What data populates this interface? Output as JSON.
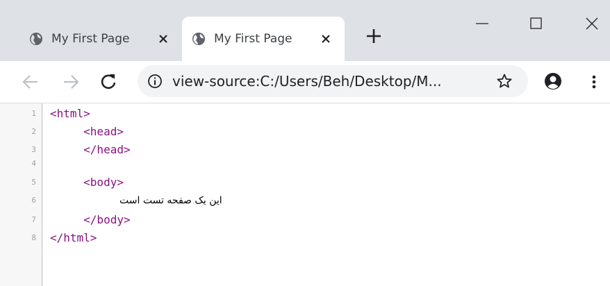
{
  "tabs": [
    {
      "title": "My First Page",
      "active": false
    },
    {
      "title": "My First Page",
      "active": true
    }
  ],
  "window_controls": [
    "minimize",
    "maximize",
    "close"
  ],
  "toolbar": {
    "url": "view-source:C:/Users/Beh/Desktop/M...",
    "icons": [
      "back-arrow-icon",
      "forward-arrow-icon",
      "reload-icon",
      "info-icon",
      "star-icon",
      "profile-icon",
      "menu-icon"
    ]
  },
  "source": {
    "lines": [
      {
        "num": "1",
        "code": "<html>"
      },
      {
        "num": "2",
        "code": "     <head>"
      },
      {
        "num": "3",
        "code": "     </head>"
      },
      {
        "num": "4",
        "code": ""
      },
      {
        "num": "5",
        "code": "     <body>"
      },
      {
        "num": "6",
        "code": "این یک صفحه تست است"
      },
      {
        "num": "7",
        "code": "     </body>"
      },
      {
        "num": "8",
        "code": "</html>"
      }
    ]
  },
  "colors": {
    "tab_strip": "#dee1e6",
    "omnibox": "#f1f3f4",
    "tag": "#881280",
    "gutter": "#f7f7f7"
  }
}
